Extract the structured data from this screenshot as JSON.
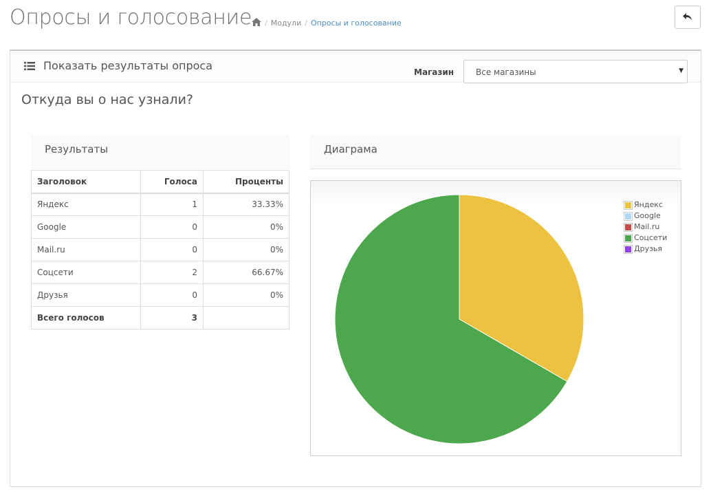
{
  "header": {
    "title": "Опросы и голосование",
    "breadcrumb": [
      "Модули",
      "Опросы и голосование"
    ]
  },
  "panel": {
    "title": "Показать результаты опроса",
    "store_label": "Магазин",
    "store_value": "Все магазины",
    "question": "Откуда вы о нас узнали?"
  },
  "results": {
    "heading": "Результаты",
    "columns": [
      "Заголовок",
      "Голоса",
      "Проценты"
    ],
    "rows": [
      {
        "title": "Яндекс",
        "votes": "1",
        "percent": "33.33%"
      },
      {
        "title": "Google",
        "votes": "0",
        "percent": "0%"
      },
      {
        "title": "Mail.ru",
        "votes": "0",
        "percent": "0%"
      },
      {
        "title": "Соцсети",
        "votes": "2",
        "percent": "66.67%"
      },
      {
        "title": "Друзья",
        "votes": "0",
        "percent": "0%"
      }
    ],
    "total_label": "Всего голосов",
    "total_votes": "3"
  },
  "diagram": {
    "heading": "Диаграма"
  },
  "chart_data": {
    "type": "pie",
    "title": "",
    "categories": [
      "Яндекс",
      "Google",
      "Mail.ru",
      "Соцсети",
      "Друзья"
    ],
    "values": [
      1,
      0,
      0,
      2,
      0
    ],
    "colors": [
      "#edc240",
      "#afd8f8",
      "#cb4b4b",
      "#4da74d",
      "#9440ed"
    ],
    "legend": "top-right"
  }
}
